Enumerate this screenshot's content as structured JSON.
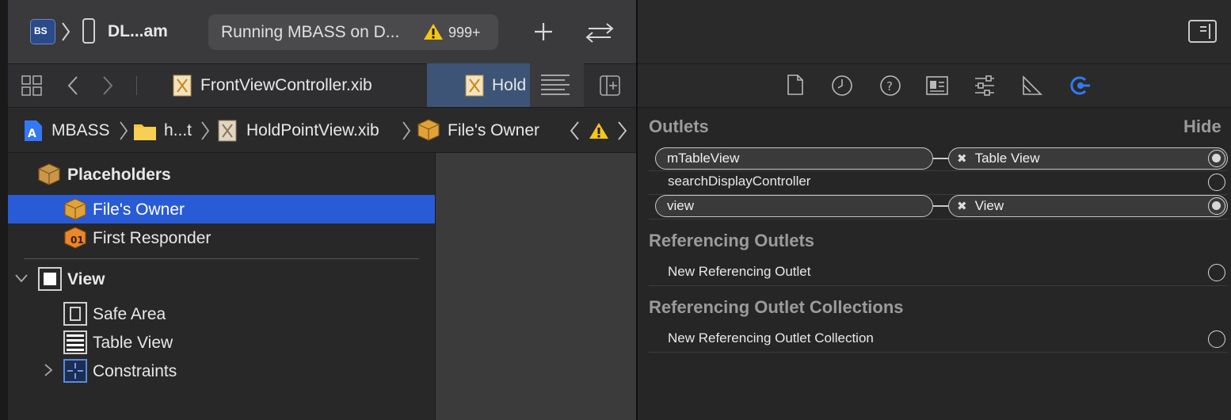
{
  "toolbar": {
    "scheme_badge": "BS",
    "device_name": "DL...am",
    "status_text": "Running MBASS on D...",
    "warning_count": "999+"
  },
  "tabs": {
    "tab1_label": "FrontViewController.xib",
    "tab2_label": "Hold"
  },
  "breadcrumb": {
    "project": "MBASS",
    "folder": "h...t",
    "file": "HoldPointView.xib",
    "item": "File's Owner"
  },
  "outline": {
    "placeholders_label": "Placeholders",
    "files_owner": "File's Owner",
    "first_responder": "First Responder",
    "view": "View",
    "safe_area": "Safe Area",
    "table_view": "Table View",
    "constraints": "Constraints"
  },
  "inspector": {
    "outlets_title": "Outlets",
    "hide_label": "Hide",
    "outlets": [
      {
        "name": "mTableView",
        "target": "Table View"
      },
      {
        "name": "searchDisplayController",
        "target": ""
      },
      {
        "name": "view",
        "target": "View"
      }
    ],
    "referencing_outlets_title": "Referencing Outlets",
    "new_referencing_outlet": "New Referencing Outlet",
    "referencing_collections_title": "Referencing Outlet Collections",
    "new_referencing_collection": "New Referencing Outlet Collection"
  },
  "colors": {
    "accent": "#2a5bd7",
    "connections_icon": "#2f7bf5",
    "warning": "#f5c518"
  }
}
